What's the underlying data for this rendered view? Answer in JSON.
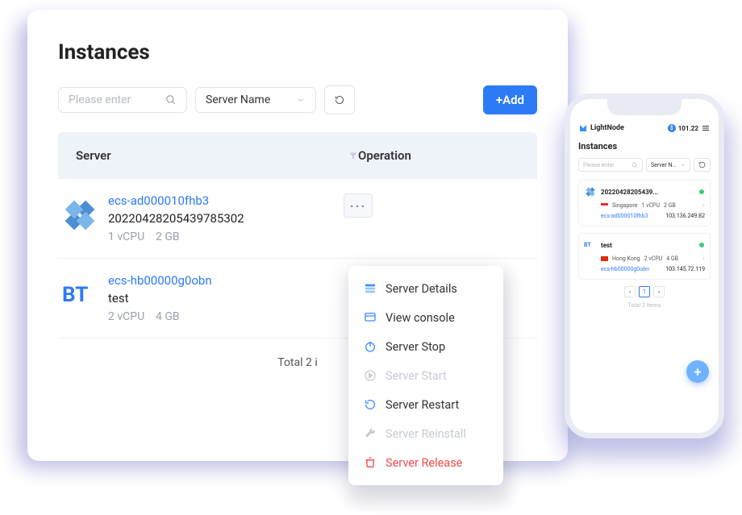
{
  "desktop": {
    "title": "Instances",
    "search_placeholder": "Please enter",
    "select_label": "Server Name",
    "add_label": "+Add",
    "columns": {
      "server": "Server",
      "operation": "Operation"
    },
    "rows": [
      {
        "link": "ecs-ad000010fhb3",
        "name": "20220428205439785302",
        "vcpu": "1 vCPU",
        "ram": "2 GB",
        "os": "centos"
      },
      {
        "link": "ecs-hb00000g0obn",
        "name": "test",
        "vcpu": "2 vCPU",
        "ram": "4 GB",
        "os": "bt"
      }
    ],
    "pager_text": "Total 2 i"
  },
  "menu": {
    "items": [
      {
        "label": "Server Details",
        "state": "normal",
        "icon": "details"
      },
      {
        "label": "View console",
        "state": "normal",
        "icon": "console"
      },
      {
        "label": "Server Stop",
        "state": "normal",
        "icon": "power"
      },
      {
        "label": "Server Start",
        "state": "disabled",
        "icon": "play"
      },
      {
        "label": "Server Restart",
        "state": "normal",
        "icon": "restart"
      },
      {
        "label": "Server Reinstall",
        "state": "disabled",
        "icon": "wrench"
      },
      {
        "label": "Server Release",
        "state": "danger",
        "icon": "trash"
      }
    ]
  },
  "phone": {
    "brand": "LightNode",
    "balance": "101.22",
    "title": "Instances",
    "search_placeholder": "Please enter",
    "select_label": "Server N...",
    "cards": [
      {
        "title": "20220428205439...",
        "region": "Singapore",
        "flag": "sg",
        "vcpu": "1 vCPU",
        "ram": "2 GB",
        "ecs": "ecs-ad000010fhb3",
        "ip": "103.136.249.82"
      },
      {
        "title": "test",
        "region": "Hong Kong",
        "flag": "hk",
        "vcpu": "2 vCPU",
        "ram": "4 GB",
        "ecs": "ecs-hb00000g0obn",
        "ip": "103.145.72.119"
      }
    ],
    "page": "1",
    "total": "Total 2 Items"
  }
}
